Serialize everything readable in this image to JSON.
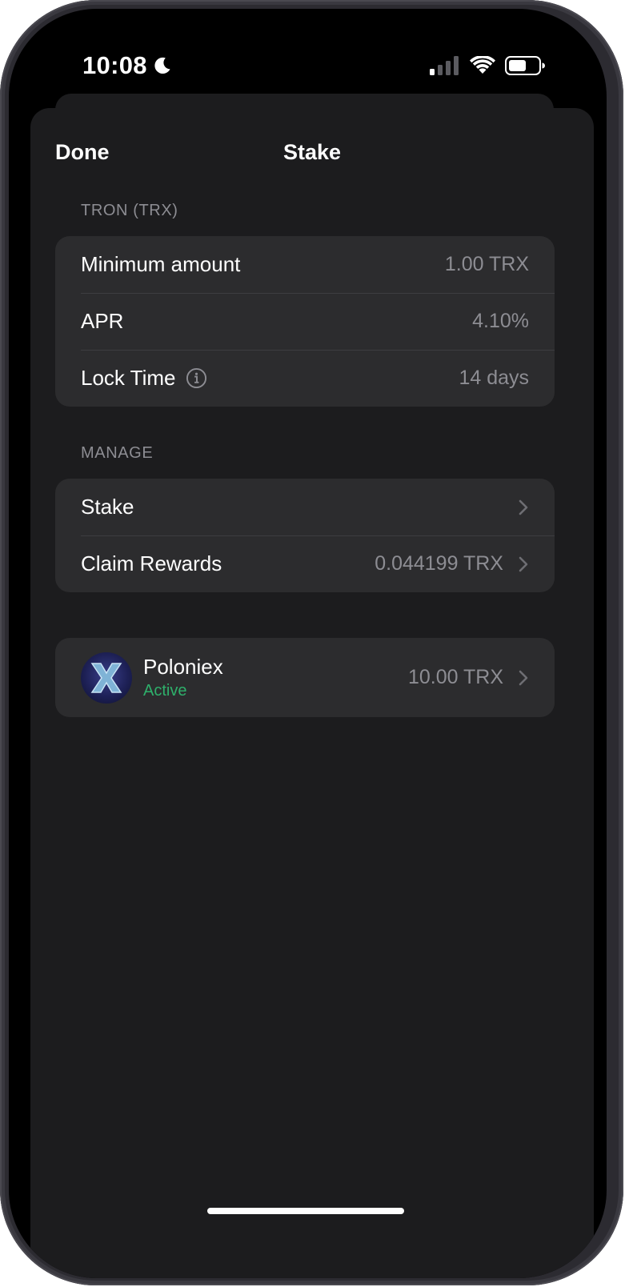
{
  "status_bar": {
    "time": "10:08"
  },
  "nav": {
    "done_label": "Done",
    "title": "Stake"
  },
  "info_section": {
    "header": "TRON (TRX)",
    "rows": [
      {
        "label": "Minimum amount",
        "value": "1.00 TRX"
      },
      {
        "label": "APR",
        "value": "4.10%"
      },
      {
        "label": "Lock Time",
        "value": "14 days",
        "icon": "info-icon"
      }
    ]
  },
  "manage_section": {
    "header": "MANAGE",
    "rows": [
      {
        "label": "Stake",
        "value": ""
      },
      {
        "label": "Claim Rewards",
        "value": "0.044199 TRX"
      }
    ]
  },
  "validator": {
    "name": "Poloniex",
    "status": "Active",
    "amount": "10.00 TRX",
    "status_color": "#2eb06b"
  },
  "colors": {
    "background": "#1c1c1e",
    "card": "#2c2c2e",
    "secondary_text": "#8d8d93"
  }
}
